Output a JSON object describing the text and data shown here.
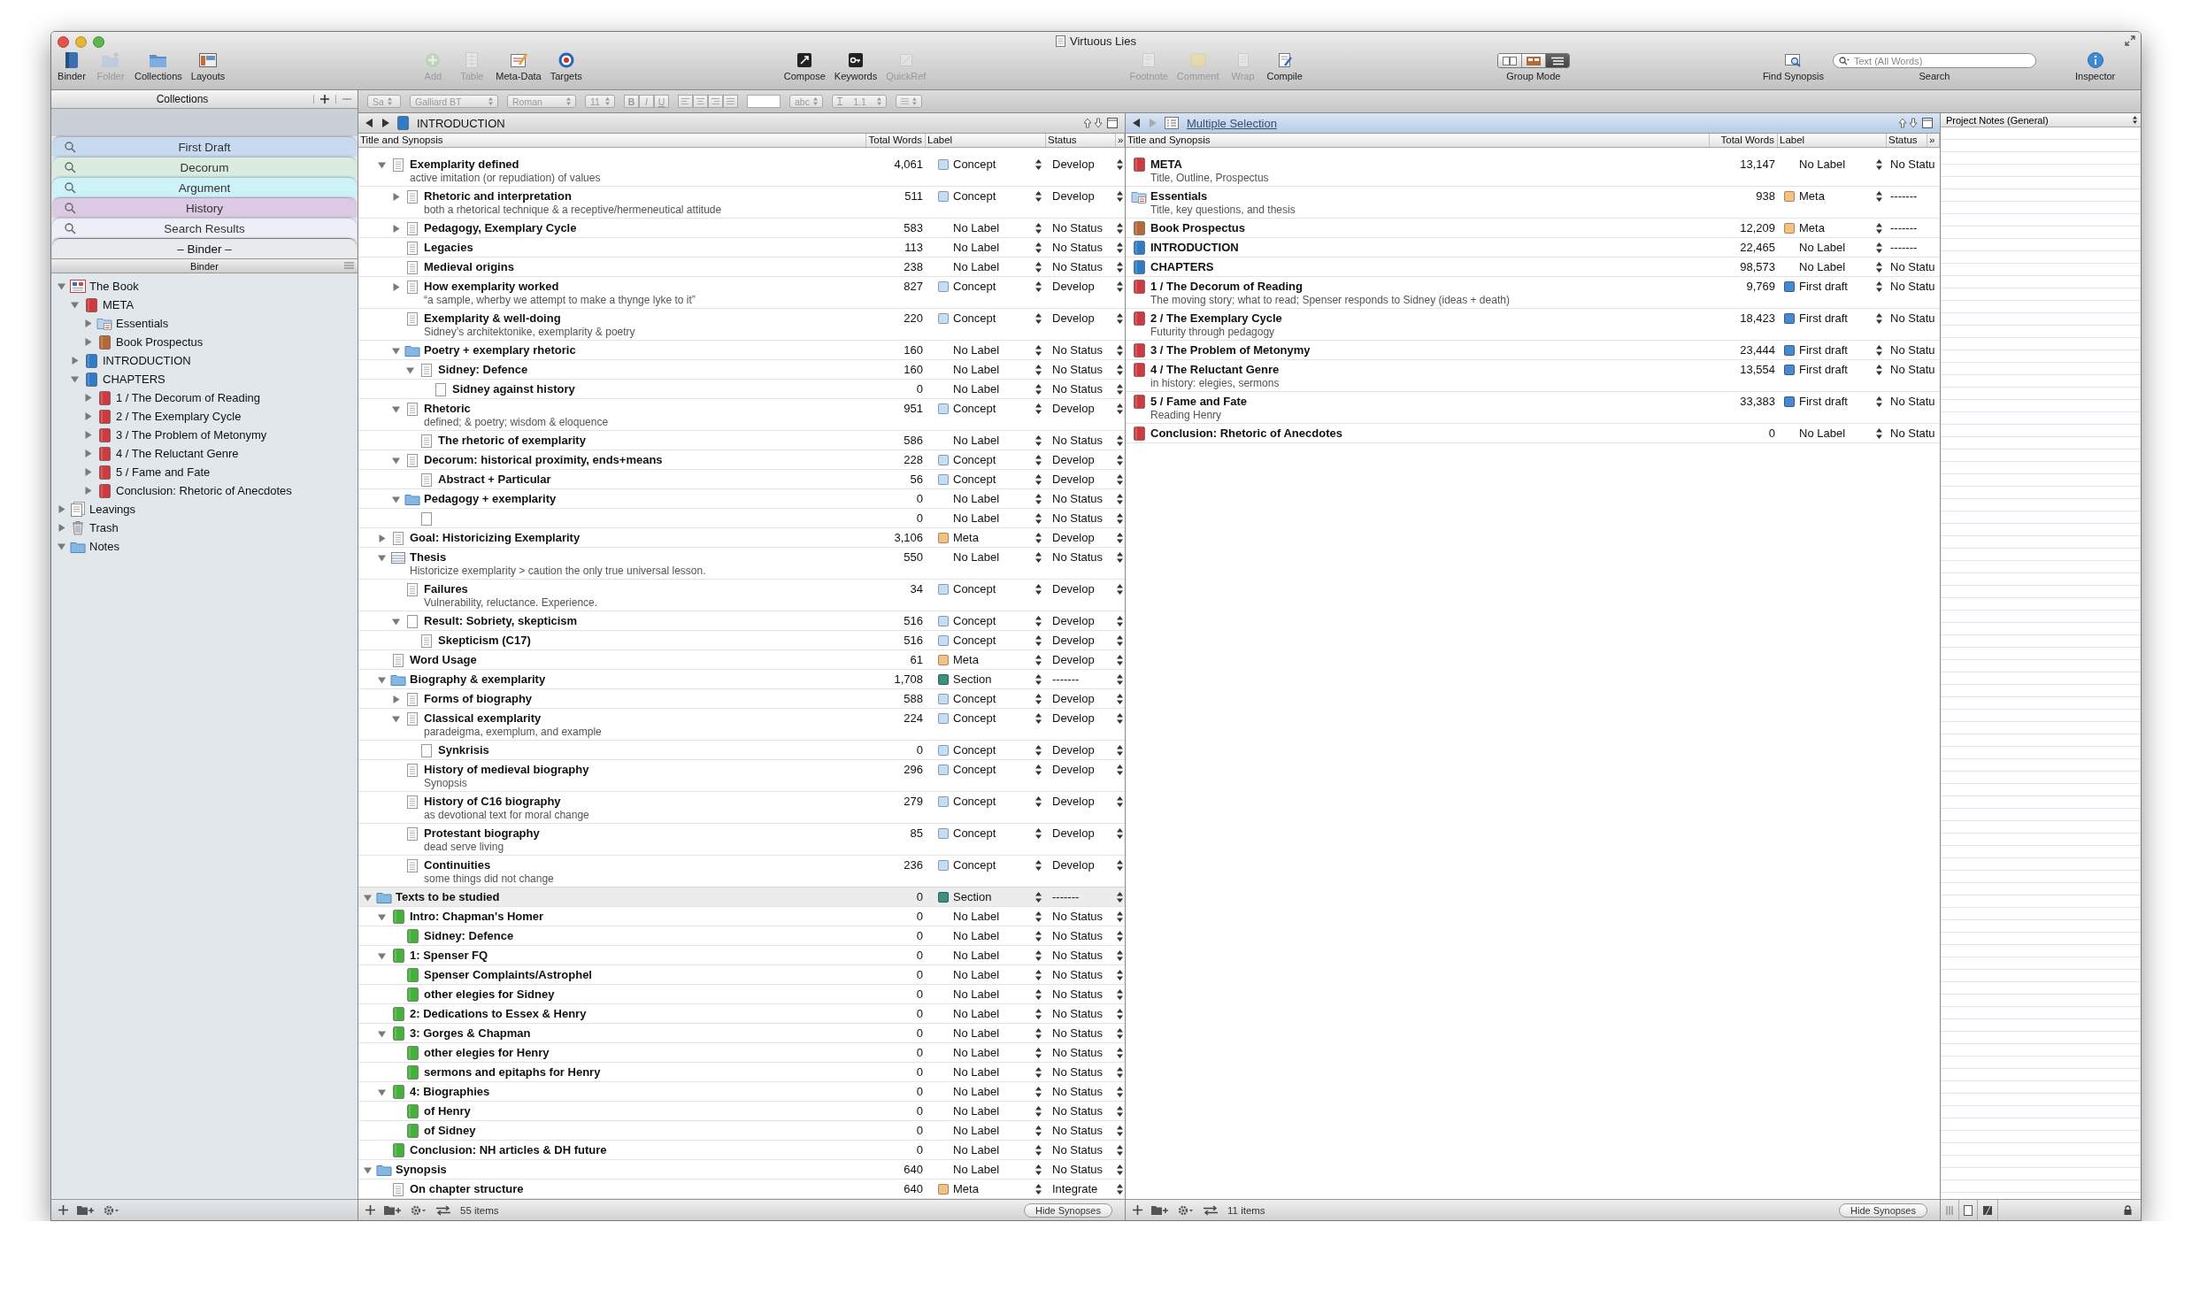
{
  "window": {
    "title": "Virtuous Lies"
  },
  "toolbar": {
    "groups": [
      {
        "items": [
          {
            "label": "Binder",
            "disabled": false
          },
          {
            "label": "Folder",
            "disabled": true
          },
          {
            "label": "Collections",
            "disabled": false
          },
          {
            "label": "Layouts",
            "disabled": false
          }
        ]
      },
      {
        "items": [
          {
            "label": "Add",
            "disabled": true
          },
          {
            "label": "Table",
            "disabled": true
          },
          {
            "label": "Meta-Data",
            "disabled": false
          },
          {
            "label": "Targets",
            "disabled": false
          }
        ]
      },
      {
        "items": [
          {
            "label": "Compose",
            "disabled": false
          },
          {
            "label": "Keywords",
            "disabled": false
          },
          {
            "label": "QuickRef",
            "disabled": true
          }
        ]
      },
      {
        "items": [
          {
            "label": "Footnote",
            "disabled": true
          },
          {
            "label": "Comment",
            "disabled": true
          },
          {
            "label": "Wrap",
            "disabled": true
          },
          {
            "label": "Compile",
            "disabled": false
          }
        ]
      }
    ],
    "group_mode": {
      "label": "Group Mode",
      "segments": [
        {
          "selected": false
        },
        {
          "selected": false
        },
        {
          "selected": true
        }
      ]
    },
    "find_synopsis": {
      "label": "Find Synopsis"
    },
    "search": {
      "placeholder": "Text (All Words)",
      "label": "Search"
    },
    "inspector": {
      "label": "Inspector"
    }
  },
  "format_bar": {
    "disabled": true,
    "style": "Sa",
    "font": "Galliard BT",
    "typeface": "Roman",
    "size": "11",
    "bold": "B",
    "italic": "I",
    "underline": "U",
    "highlight": "abc",
    "line_spacing": "1.1"
  },
  "collections": {
    "title": "Collections",
    "tabs": [
      {
        "label": "First Draft",
        "color": "#c8daef",
        "search": true,
        "selected": false
      },
      {
        "label": "Decorum",
        "color": "#d9ecdf",
        "search": true,
        "selected": false
      },
      {
        "label": "Argument",
        "color": "#cdf3f8",
        "search": true,
        "selected": false
      },
      {
        "label": "History",
        "color": "#dcc9e4",
        "search": true,
        "selected": false
      },
      {
        "label": "Search Results",
        "color": "#eeeef9",
        "search": true,
        "selected": false
      },
      {
        "label": "– Binder –",
        "color": "#e8eaee",
        "search": false,
        "selected": true
      }
    ]
  },
  "binder": {
    "title": "Binder",
    "items": [
      {
        "title": "The Book",
        "kind": "project",
        "expanded": true,
        "children": [
          {
            "title": "META",
            "kind": "notebook",
            "color": "#cc3b3f",
            "expanded": true,
            "children": [
              {
                "title": "Essentials",
                "kind": "folder-doc",
                "expanded": false
              },
              {
                "title": "Book Prospectus",
                "kind": "notebook",
                "color": "#b4693a",
                "expanded": false
              }
            ]
          },
          {
            "title": "INTRODUCTION",
            "kind": "notebook",
            "color": "#2f7bc4",
            "expanded": false
          },
          {
            "title": "CHAPTERS",
            "kind": "notebook",
            "color": "#2f7bc4",
            "expanded": true,
            "children": [
              {
                "title": "1 / The Decorum of Reading",
                "kind": "notebook",
                "color": "#cc3b3f",
                "expanded": false
              },
              {
                "title": "2 / The Exemplary Cycle",
                "kind": "notebook",
                "color": "#cc3b3f",
                "expanded": false
              },
              {
                "title": "3 / The Problem of Metonymy",
                "kind": "notebook",
                "color": "#cc3b3f",
                "expanded": false
              },
              {
                "title": "4 / The Reluctant Genre",
                "kind": "notebook",
                "color": "#cc3b3f",
                "expanded": false
              },
              {
                "title": "5 / Fame and Fate",
                "kind": "notebook",
                "color": "#cc3b3f",
                "expanded": false
              },
              {
                "title": "Conclusion: Rhetoric of Anecdotes",
                "kind": "notebook",
                "color": "#cc3b3f",
                "expanded": false
              }
            ]
          }
        ]
      },
      {
        "title": "Leavings",
        "kind": "pages",
        "expanded": false
      },
      {
        "title": "Trash",
        "kind": "trash",
        "expanded": false
      },
      {
        "title": "Notes",
        "kind": "folder",
        "expanded": true
      }
    ]
  },
  "left_editor": {
    "title": "INTRODUCTION",
    "back_disabled": false,
    "forward_disabled": false,
    "focused": false,
    "columns": [
      "Title and Synopsis",
      "Total Words",
      "Label",
      "Status"
    ],
    "more_columns": "»",
    "rows_under_hidden_parent": [
      {
        "title": "Exemplarity defined",
        "synopsis": "active imitation (or repudiation) of values",
        "words": "4,061",
        "label": {
          "text": "Concept",
          "color": "#c4dff5"
        },
        "status": "Develop",
        "kind": "document",
        "expanded": true,
        "selected": false,
        "children": [
          {
            "title": "Rhetoric and interpretation",
            "synopsis": "both a rhetorical technique & a receptive/hermeneutical attitude",
            "words": "511",
            "label": {
              "text": "Concept",
              "color": "#c4dff5"
            },
            "status": "Develop",
            "kind": "document",
            "expanded": false,
            "selected": false
          },
          {
            "title": "Pedagogy, Exemplary Cycle",
            "words": "583",
            "label": {
              "text": "No Label"
            },
            "status": "No Status",
            "kind": "document",
            "expanded": false,
            "selected": false
          },
          {
            "title": "Legacies",
            "words": "113",
            "label": {
              "text": "No Label"
            },
            "status": "No Status",
            "kind": "document",
            "selected": false
          },
          {
            "title": "Medieval origins",
            "words": "238",
            "label": {
              "text": "No Label"
            },
            "status": "No Status",
            "kind": "document",
            "selected": false
          },
          {
            "title": "How exemplarity worked",
            "synopsis": "“a sample, wherby we attempt to make a thynge lyke to it”",
            "words": "827",
            "label": {
              "text": "Concept",
              "color": "#c4dff5"
            },
            "status": "Develop",
            "kind": "document",
            "expanded": false,
            "selected": false
          },
          {
            "title": "Exemplarity & well-doing",
            "synopsis": "Sidney’s architektonike, exemplarity & poetry",
            "words": "220",
            "label": {
              "text": "Concept",
              "color": "#c4dff5"
            },
            "status": "Develop",
            "kind": "document",
            "selected": false
          },
          {
            "title": "Poetry + exemplary rhetoric",
            "words": "160",
            "label": {
              "text": "No Label"
            },
            "status": "No Status",
            "kind": "folder",
            "expanded": true,
            "selected": false,
            "children": [
              {
                "title": "Sidney: Defence",
                "words": "160",
                "label": {
                  "text": "No Label"
                },
                "status": "No Status",
                "kind": "document",
                "expanded": true,
                "selected": false,
                "children": [
                  {
                    "title": "Sidney against history",
                    "words": "0",
                    "label": {
                      "text": "No Label"
                    },
                    "status": "No Status",
                    "kind": "blank",
                    "selected": false
                  }
                ]
              }
            ]
          },
          {
            "title": "Rhetoric",
            "synopsis": "defined; & poetry; wisdom & eloquence",
            "words": "951",
            "label": {
              "text": "Concept",
              "color": "#c4dff5"
            },
            "status": "Develop",
            "kind": "document",
            "expanded": true,
            "selected": false,
            "children": [
              {
                "title": "The rhetoric of exemplarity",
                "words": "586",
                "label": {
                  "text": "No Label"
                },
                "status": "No Status",
                "kind": "document",
                "selected": false
              }
            ]
          },
          {
            "title": "Decorum: historical proximity, ends+means",
            "words": "228",
            "label": {
              "text": "Concept",
              "color": "#c4dff5"
            },
            "status": "Develop",
            "kind": "document",
            "expanded": true,
            "selected": false,
            "children": [
              {
                "title": "Abstract + Particular",
                "words": "56",
                "label": {
                  "text": "Concept",
                  "color": "#c4dff5"
                },
                "status": "Develop",
                "kind": "document",
                "selected": false
              }
            ]
          },
          {
            "title": "Pedagogy + exemplarity",
            "words": "0",
            "label": {
              "text": "No Label"
            },
            "status": "No Status",
            "kind": "folder",
            "expanded": true,
            "selected": false,
            "children": [
              {
                "words": "0",
                "label": {
                  "text": "No Label"
                },
                "status": "No Status",
                "kind": "blank",
                "selected": false
              }
            ]
          }
        ]
      },
      {
        "title": "Goal: Historicizing Exemplarity",
        "words": "3,106",
        "label": {
          "text": "Meta",
          "color": "#f2c184"
        },
        "status": "Develop",
        "kind": "document",
        "expanded": false,
        "selected": false
      },
      {
        "title": "Thesis",
        "synopsis": "Historicize exemplarity > caution the only true universal lesson.",
        "words": "550",
        "label": {
          "text": "No Label"
        },
        "status": "No Status",
        "kind": "cards",
        "expanded": true,
        "selected": false,
        "children": [
          {
            "title": "Failures",
            "synopsis": "Vulnerability, reluctance. Experience.",
            "words": "34",
            "label": {
              "text": "Concept",
              "color": "#c4dff5"
            },
            "status": "Develop",
            "kind": "document",
            "selected": false
          },
          {
            "title": "Result: Sobriety, skepticism",
            "words": "516",
            "label": {
              "text": "Concept",
              "color": "#c4dff5"
            },
            "status": "Develop",
            "kind": "blank",
            "expanded": true,
            "selected": false,
            "children": [
              {
                "title": "Skepticism (C17)",
                "words": "516",
                "label": {
                  "text": "Concept",
                  "color": "#c4dff5"
                },
                "status": "Develop",
                "kind": "document",
                "selected": false
              }
            ]
          }
        ]
      },
      {
        "title": "Word Usage",
        "words": "61",
        "label": {
          "text": "Meta",
          "color": "#f2c184"
        },
        "status": "Develop",
        "kind": "document",
        "selected": false
      },
      {
        "title": "Biography & exemplarity",
        "words": "1,708",
        "label": {
          "text": "Section",
          "color": "#3f8f80"
        },
        "status": "-------",
        "kind": "folder",
        "expanded": true,
        "selected": false,
        "children": [
          {
            "title": "Forms of biography",
            "words": "588",
            "label": {
              "text": "Concept",
              "color": "#c4dff5"
            },
            "status": "Develop",
            "kind": "document",
            "expanded": false,
            "selected": false
          },
          {
            "title": "Classical exemplarity",
            "synopsis": "paradeigma, exemplum, and example",
            "words": "224",
            "label": {
              "text": "Concept",
              "color": "#c4dff5"
            },
            "status": "Develop",
            "kind": "document",
            "expanded": true,
            "selected": false,
            "children": [
              {
                "title": "Synkrisis",
                "words": "0",
                "label": {
                  "text": "Concept",
                  "color": "#c4dff5"
                },
                "status": "Develop",
                "kind": "blank",
                "selected": false
              }
            ]
          },
          {
            "title": "History of medieval biography",
            "synopsis": "Synopsis",
            "words": "296",
            "label": {
              "text": "Concept",
              "color": "#c4dff5"
            },
            "status": "Develop",
            "kind": "document",
            "selected": false
          },
          {
            "title": "History of C16 biography",
            "synopsis": "as devotional text for moral change",
            "words": "279",
            "label": {
              "text": "Concept",
              "color": "#c4dff5"
            },
            "status": "Develop",
            "kind": "document",
            "selected": false
          },
          {
            "title": "Protestant biography",
            "synopsis": "dead serve living",
            "words": "85",
            "label": {
              "text": "Concept",
              "color": "#c4dff5"
            },
            "status": "Develop",
            "kind": "document",
            "selected": false
          },
          {
            "title": "Continuities",
            "synopsis": "some things did not change",
            "words": "236",
            "label": {
              "text": "Concept",
              "color": "#c4dff5"
            },
            "status": "Develop",
            "kind": "document",
            "selected": false
          }
        ]
      }
    ],
    "rows": [
      {
        "title": "Texts to be studied",
        "words": "0",
        "label": {
          "text": "Section",
          "color": "#3f8f80"
        },
        "status": "-------",
        "kind": "folder",
        "expanded": true,
        "selected": true,
        "children": [
          {
            "title": "Intro: Chapman's Homer",
            "words": "0",
            "label": {
              "text": "No Label"
            },
            "status": "No Status",
            "kind": "notebook",
            "color": "#45b03c",
            "expanded": true,
            "selected": false,
            "children": [
              {
                "title": "Sidney: Defence",
                "words": "0",
                "label": {
                  "text": "No Label"
                },
                "status": "No Status",
                "kind": "notebook",
                "color": "#45b03c",
                "selected": false
              }
            ]
          },
          {
            "title": "1: Spenser FQ",
            "words": "0",
            "label": {
              "text": "No Label"
            },
            "status": "No Status",
            "kind": "notebook",
            "color": "#45b03c",
            "expanded": true,
            "selected": false,
            "children": [
              {
                "title": "Spenser Complaints/Astrophel",
                "words": "0",
                "label": {
                  "text": "No Label"
                },
                "status": "No Status",
                "kind": "notebook",
                "color": "#45b03c",
                "selected": false
              },
              {
                "title": "other elegies for Sidney",
                "words": "0",
                "label": {
                  "text": "No Label"
                },
                "status": "No Status",
                "kind": "notebook",
                "color": "#45b03c",
                "selected": false
              }
            ]
          },
          {
            "title": "2: Dedications to Essex & Henry",
            "words": "0",
            "label": {
              "text": "No Label"
            },
            "status": "No Status",
            "kind": "notebook",
            "color": "#45b03c",
            "selected": false
          },
          {
            "title": "3: Gorges & Chapman",
            "words": "0",
            "label": {
              "text": "No Label"
            },
            "status": "No Status",
            "kind": "notebook",
            "color": "#45b03c",
            "expanded": true,
            "selected": false,
            "children": [
              {
                "title": "other elegies for Henry",
                "words": "0",
                "label": {
                  "text": "No Label"
                },
                "status": "No Status",
                "kind": "notebook",
                "color": "#45b03c",
                "selected": false
              },
              {
                "title": "sermons and epitaphs for Henry",
                "words": "0",
                "label": {
                  "text": "No Label"
                },
                "status": "No Status",
                "kind": "notebook",
                "color": "#45b03c",
                "selected": false
              }
            ]
          },
          {
            "title": "4: Biographies",
            "words": "0",
            "label": {
              "text": "No Label"
            },
            "status": "No Status",
            "kind": "notebook",
            "color": "#45b03c",
            "expanded": true,
            "selected": false,
            "children": [
              {
                "title": "of Henry",
                "words": "0",
                "label": {
                  "text": "No Label"
                },
                "status": "No Status",
                "kind": "notebook",
                "color": "#45b03c",
                "selected": false
              },
              {
                "title": "of Sidney",
                "words": "0",
                "label": {
                  "text": "No Label"
                },
                "status": "No Status",
                "kind": "notebook",
                "color": "#45b03c",
                "selected": false
              }
            ]
          },
          {
            "title": "Conclusion: NH articles & DH future",
            "words": "0",
            "label": {
              "text": "No Label"
            },
            "status": "No Status",
            "kind": "notebook",
            "color": "#45b03c",
            "selected": false
          }
        ]
      },
      {
        "title": "Synopsis",
        "words": "640",
        "label": {
          "text": "No Label"
        },
        "status": "No Status",
        "kind": "folder",
        "expanded": true,
        "selected": false,
        "children": [
          {
            "title": "On chapter structure",
            "words": "640",
            "label": {
              "text": "Meta",
              "color": "#f2c184"
            },
            "status": "Integrate",
            "kind": "document",
            "selected": false
          }
        ]
      }
    ],
    "footer": {
      "count": "55 items",
      "button": "Hide Synopses"
    }
  },
  "right_editor": {
    "title": "Multiple Selection",
    "back_disabled": false,
    "forward_disabled": true,
    "focused": true,
    "columns": [
      "Title and Synopsis",
      "Total Words",
      "Label",
      "Status"
    ],
    "more_columns": "»",
    "rows": [
      {
        "title": "META",
        "synopsis": "Title, Outline, Prospectus",
        "words": "13,147",
        "label": {
          "text": "No Label"
        },
        "status": "No Statu",
        "kind": "notebook",
        "color": "#cc3b3f"
      },
      {
        "title": "Essentials",
        "synopsis": "Title, key questions, and thesis",
        "words": "938",
        "label": {
          "text": "Meta",
          "color": "#f2c184"
        },
        "status": "-------",
        "kind": "folder-doc"
      },
      {
        "title": "Book Prospectus",
        "words": "12,209",
        "label": {
          "text": "Meta",
          "color": "#f2c184"
        },
        "status": "-------",
        "kind": "notebook",
        "color": "#b4693a"
      },
      {
        "title": "INTRODUCTION",
        "words": "22,465",
        "label": {
          "text": "No Label"
        },
        "status": "-------",
        "kind": "notebook",
        "color": "#2f7bc4"
      },
      {
        "title": "CHAPTERS",
        "words": "98,573",
        "label": {
          "text": "No Label"
        },
        "status": "No Statu",
        "kind": "notebook",
        "color": "#2f7bc4"
      },
      {
        "title": "1 / The Decorum of Reading",
        "synopsis": "The moving story; what to read; Spenser responds to Sidney (ideas + death)",
        "words": "9,769",
        "label": {
          "text": "First draft",
          "color": "#4a88cc"
        },
        "status": "No Statu",
        "kind": "notebook",
        "color": "#cc3b3f"
      },
      {
        "title": "2 / The Exemplary Cycle",
        "synopsis": "Futurity through pedagogy",
        "words": "18,423",
        "label": {
          "text": "First draft",
          "color": "#4a88cc"
        },
        "status": "No Statu",
        "kind": "notebook",
        "color": "#cc3b3f"
      },
      {
        "title": "3 / The Problem of Metonymy",
        "words": "23,444",
        "label": {
          "text": "First draft",
          "color": "#4a88cc"
        },
        "status": "No Statu",
        "kind": "notebook",
        "color": "#cc3b3f"
      },
      {
        "title": "4 / The Reluctant Genre",
        "synopsis": "in history: elegies, sermons",
        "words": "13,554",
        "label": {
          "text": "First draft",
          "color": "#4a88cc"
        },
        "status": "No Statu",
        "kind": "notebook",
        "color": "#cc3b3f"
      },
      {
        "title": "5 / Fame and Fate",
        "synopsis": "Reading Henry",
        "words": "33,383",
        "label": {
          "text": "First draft",
          "color": "#4a88cc"
        },
        "status": "No Statu",
        "kind": "notebook",
        "color": "#cc3b3f"
      },
      {
        "title": "Conclusion: Rhetoric of Anecdotes",
        "words": "0",
        "label": {
          "text": "No Label"
        },
        "status": "No Statu",
        "kind": "notebook",
        "color": "#cc3b3f"
      }
    ],
    "footer": {
      "count": "11 items",
      "button": "Hide Synopses"
    }
  },
  "inspector": {
    "notes_title": "Project Notes (General)"
  }
}
